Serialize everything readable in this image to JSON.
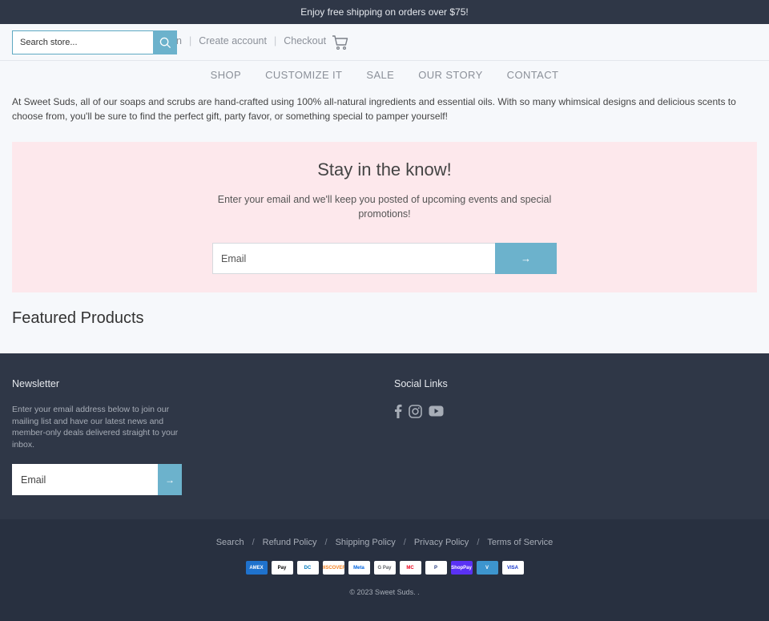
{
  "announcement": {
    "text": "Enjoy free shipping on orders over $75!"
  },
  "header": {
    "search_placeholder": "Search store...",
    "links": [
      "n",
      "Create account",
      "Checkout"
    ],
    "cart_icon": "cart-icon"
  },
  "nav": {
    "items": [
      "SHOP",
      "CUSTOMIZE IT",
      "SALE",
      "OUR STORY",
      "CONTACT"
    ]
  },
  "intro": {
    "text": "At Sweet Suds, all of our soaps and scrubs are hand-crafted using 100% all-natural ingredients and essential oils. With so many whimsical designs and delicious scents to choose from, you'll be sure to find the perfect gift, party favor, or something special to pamper yourself!"
  },
  "newsletter_band": {
    "title": "Stay in the know!",
    "text": "Enter your email and we'll keep you posted of upcoming events and special promotions!",
    "email_placeholder": "Email",
    "submit_label": "→"
  },
  "featured": {
    "title": "Featured Products"
  },
  "footer": {
    "newsletter_title": "Newsletter",
    "newsletter_text": "Enter your email address below to join our mailing list and have our latest news and member-only deals delivered straight to your inbox.",
    "email_placeholder": "Email",
    "submit_label": "→",
    "social_title": "Social Links",
    "social_icons": [
      "facebook-icon",
      "instagram-icon",
      "youtube-icon"
    ]
  },
  "bottom": {
    "links": [
      "Search",
      "Refund Policy",
      "Shipping Policy",
      "Privacy Policy",
      "Terms of Service"
    ],
    "separator": "/",
    "payments": [
      {
        "label": "AMEX",
        "bg": "#1f72cd",
        "fg": "#ffffff"
      },
      {
        "label": "Pay",
        "bg": "#ffffff",
        "fg": "#000000"
      },
      {
        "label": "DC",
        "bg": "#ffffff",
        "fg": "#0079be"
      },
      {
        "label": "DISCOVER",
        "bg": "#ffffff",
        "fg": "#f48120"
      },
      {
        "label": "Meta",
        "bg": "#ffffff",
        "fg": "#0064e0"
      },
      {
        "label": "G Pay",
        "bg": "#ffffff",
        "fg": "#5f6368"
      },
      {
        "label": "MC",
        "bg": "#ffffff",
        "fg": "#eb001b"
      },
      {
        "label": "P",
        "bg": "#ffffff",
        "fg": "#253b80"
      },
      {
        "label": "ShopPay",
        "bg": "#5a31f4",
        "fg": "#ffffff"
      },
      {
        "label": "V",
        "bg": "#3d95ce",
        "fg": "#ffffff"
      },
      {
        "label": "VISA",
        "bg": "#ffffff",
        "fg": "#1434cb"
      }
    ],
    "copyright": "© 2023 Sweet Suds. ."
  },
  "colors": {
    "dark_band": "#2f3747",
    "accent": "#6cb2cc",
    "pink_band": "#fde8ec"
  }
}
